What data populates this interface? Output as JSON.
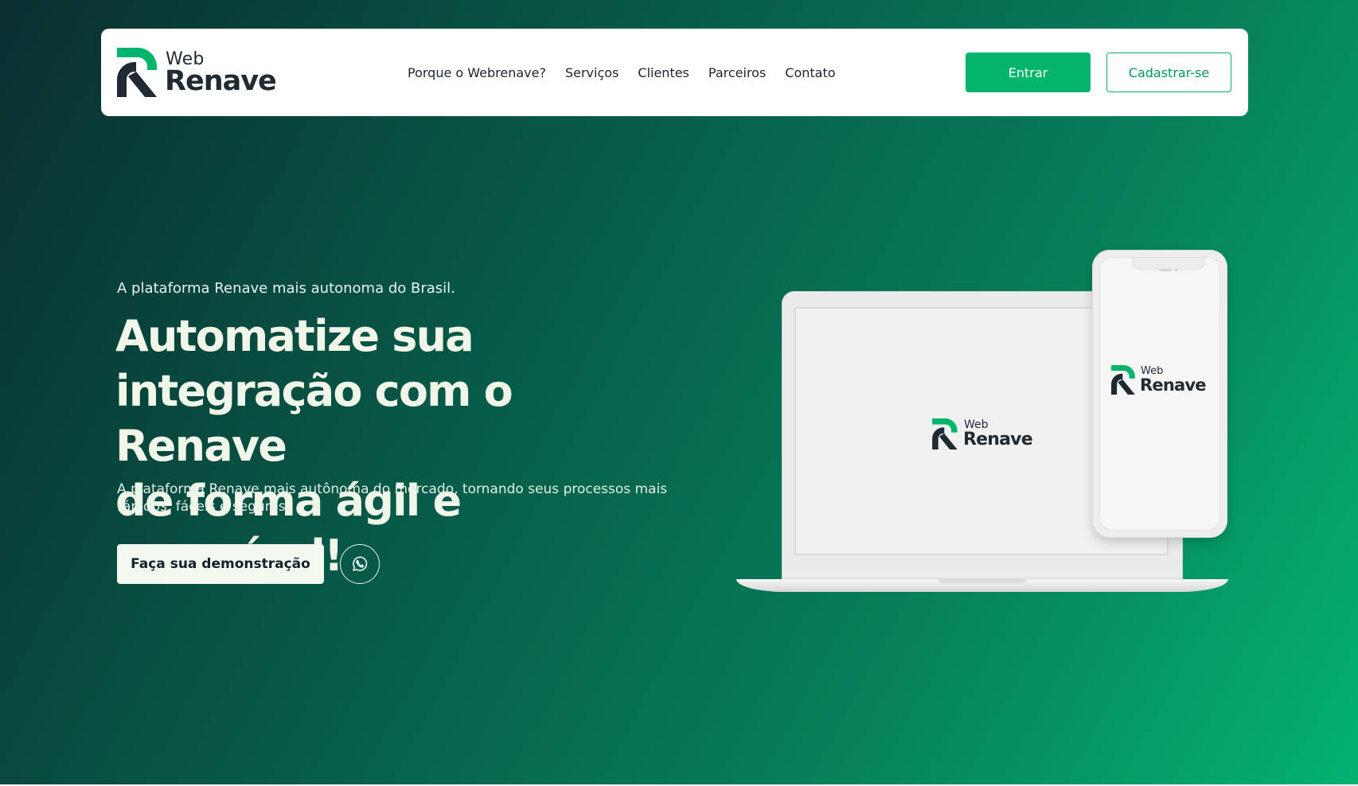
{
  "navbar": {
    "logo": {
      "web": "Web",
      "renave": "Renave"
    },
    "links": [
      {
        "label": "Porque o Webrenave?"
      },
      {
        "label": "Serviços"
      },
      {
        "label": "Clientes"
      },
      {
        "label": "Parceiros"
      },
      {
        "label": "Contato"
      }
    ],
    "login_label": "Entrar",
    "signup_label": "Cadastrar-se"
  },
  "hero": {
    "tagline": "A plataforma Renave mais autonoma do Brasil.",
    "headline_lines": [
      "Automatize sua",
      "integração com o Renave",
      "de forma ágil e acessível!"
    ],
    "subtext": "A plataforma Renave mais autônoma do mercado, tornando seus processos mais rápidos, fáceis e seguros.",
    "demo_button_label": "Faça sua demonstração",
    "whatsapp_icon": "whatsapp-icon"
  },
  "devices": {
    "laptop_logo": {
      "web": "Web",
      "renave": "Renave"
    },
    "phone_logo": {
      "web": "Web",
      "renave": "Renave"
    }
  },
  "colors": {
    "brand_green": "#03b46c",
    "logo_dark": "#1f2a33",
    "gradient_start": "#0a2f30",
    "gradient_end": "#04b270"
  }
}
